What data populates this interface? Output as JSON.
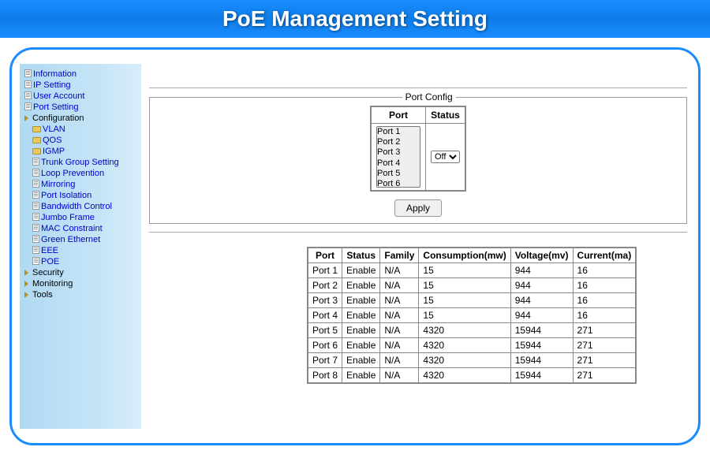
{
  "header": {
    "title": "PoE Management Setting"
  },
  "sidebar": {
    "items": [
      {
        "label": "Information",
        "type": "doc",
        "indent": 0
      },
      {
        "label": "IP Setting",
        "type": "doc",
        "indent": 0
      },
      {
        "label": "User Account",
        "type": "doc",
        "indent": 0
      },
      {
        "label": "Port Setting",
        "type": "doc",
        "indent": 0
      },
      {
        "label": "Configuration",
        "type": "tri",
        "indent": 0,
        "cat": true
      },
      {
        "label": "VLAN",
        "type": "folder",
        "indent": 1
      },
      {
        "label": "QOS",
        "type": "folder",
        "indent": 1
      },
      {
        "label": "IGMP",
        "type": "folder",
        "indent": 1
      },
      {
        "label": "Trunk Group Setting",
        "type": "doc",
        "indent": 1
      },
      {
        "label": "Loop Prevention",
        "type": "doc",
        "indent": 1
      },
      {
        "label": "Mirroring",
        "type": "doc",
        "indent": 1
      },
      {
        "label": "Port Isolation",
        "type": "doc",
        "indent": 1
      },
      {
        "label": "Bandwidth Control",
        "type": "doc",
        "indent": 1
      },
      {
        "label": "Jumbo Frame",
        "type": "doc",
        "indent": 1
      },
      {
        "label": "MAC Constraint",
        "type": "doc",
        "indent": 1
      },
      {
        "label": "Green Ethernet",
        "type": "doc",
        "indent": 1
      },
      {
        "label": "EEE",
        "type": "doc",
        "indent": 1
      },
      {
        "label": "POE",
        "type": "doc",
        "indent": 1
      },
      {
        "label": "Security",
        "type": "tri",
        "indent": 0,
        "cat": true
      },
      {
        "label": "Monitoring",
        "type": "tri",
        "indent": 0,
        "cat": true
      },
      {
        "label": "Tools",
        "type": "tri",
        "indent": 0,
        "cat": true
      }
    ]
  },
  "port_config": {
    "legend": "Port Config",
    "port_header": "Port",
    "status_header": "Status",
    "port_options": [
      "Port 1",
      "Port 2",
      "Port 3",
      "Port 4",
      "Port 5",
      "Port 6"
    ],
    "status_selected": "Off",
    "status_options": [
      "Off"
    ],
    "apply_label": "Apply"
  },
  "data_table": {
    "headers": [
      "Port",
      "Status",
      "Family",
      "Consumption(mw)",
      "Voltage(mv)",
      "Current(ma)"
    ],
    "rows": [
      [
        "Port 1",
        "Enable",
        "N/A",
        "15",
        "944",
        "16"
      ],
      [
        "Port 2",
        "Enable",
        "N/A",
        "15",
        "944",
        "16"
      ],
      [
        "Port 3",
        "Enable",
        "N/A",
        "15",
        "944",
        "16"
      ],
      [
        "Port 4",
        "Enable",
        "N/A",
        "15",
        "944",
        "16"
      ],
      [
        "Port 5",
        "Enable",
        "N/A",
        "4320",
        "15944",
        "271"
      ],
      [
        "Port 6",
        "Enable",
        "N/A",
        "4320",
        "15944",
        "271"
      ],
      [
        "Port 7",
        "Enable",
        "N/A",
        "4320",
        "15944",
        "271"
      ],
      [
        "Port 8",
        "Enable",
        "N/A",
        "4320",
        "15944",
        "271"
      ]
    ]
  }
}
